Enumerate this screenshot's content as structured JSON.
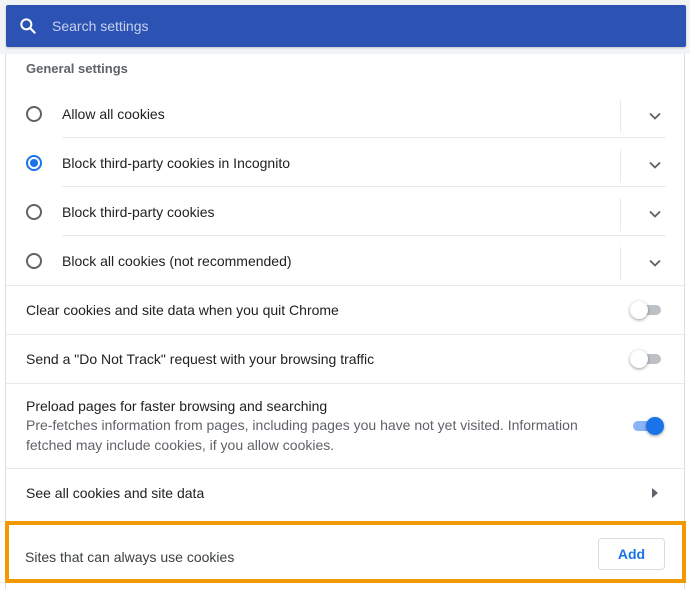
{
  "search": {
    "placeholder": "Search settings",
    "icon": "search-icon"
  },
  "general": {
    "title": "General settings",
    "options": [
      {
        "label": "Allow all cookies",
        "selected": false
      },
      {
        "label": "Block third-party cookies in Incognito",
        "selected": true
      },
      {
        "label": "Block third-party cookies",
        "selected": false
      },
      {
        "label": "Block all cookies (not recommended)",
        "selected": false
      }
    ]
  },
  "toggles": {
    "clear_on_quit": {
      "label": "Clear cookies and site data when you quit Chrome",
      "enabled": false
    },
    "do_not_track": {
      "label": "Send a \"Do Not Track\" request with your browsing traffic",
      "enabled": false
    },
    "preload": {
      "label": "Preload pages for faster browsing and searching",
      "description": "Pre-fetches information from pages, including pages you have not yet visited. Information fetched may include cookies, if you allow cookies.",
      "enabled": true
    }
  },
  "see_all": {
    "label": "See all cookies and site data"
  },
  "always_allow": {
    "label": "Sites that can always use cookies",
    "add_label": "Add"
  },
  "colors": {
    "search_bar": "#2c53b4",
    "accent": "#1a73e8",
    "highlight_border": "#f29900"
  }
}
